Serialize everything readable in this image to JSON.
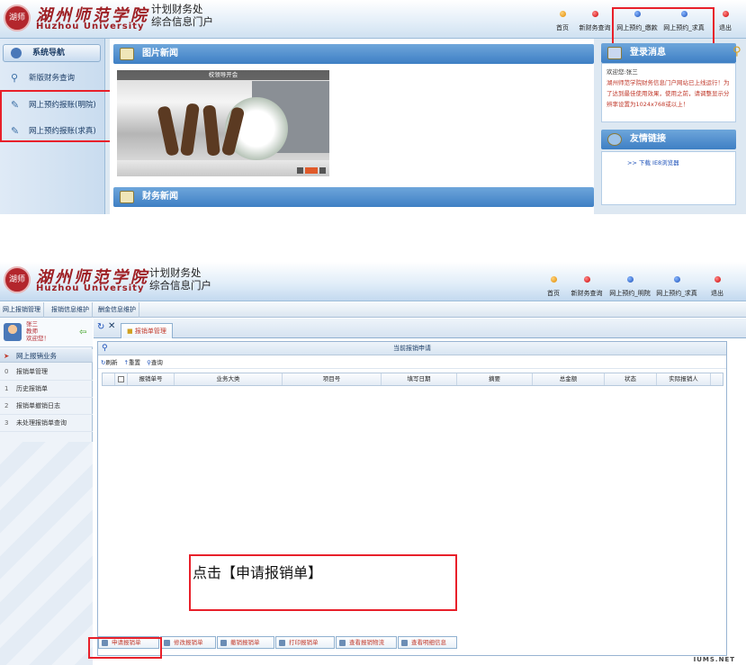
{
  "top": {
    "header": {
      "logo_seal": "湖师",
      "logo_cn": "湖州师范学院",
      "logo_en": "Huzhou University",
      "portal_line1": "计划财务处",
      "portal_line2": "综合信息门户",
      "nav": [
        {
          "label": "首页",
          "dot": "orange"
        },
        {
          "label": "新财务查询",
          "dot": "red"
        },
        {
          "label": "网上预约_缴款",
          "dot": "blue"
        },
        {
          "label": "网上预约_求真",
          "dot": "blue"
        },
        {
          "label": "退出",
          "dot": "red"
        }
      ]
    },
    "sidebar": {
      "title": "系统导航",
      "items": [
        {
          "label": "新版财务查询",
          "icon": "search-icon"
        },
        {
          "label": "网上预约报账(明院)",
          "icon": "edit-icon"
        },
        {
          "label": "网上预约报账(求真)",
          "icon": "edit-icon"
        }
      ]
    },
    "photo_news": {
      "title": "图片新闻",
      "caption": "校领导开会"
    },
    "finance_news": {
      "title": "财务新闻"
    },
    "login_msg": {
      "title": "登录消息",
      "greeting": "欢迎您:张三",
      "body": "湖州师范学院财务信息门户网站已上线运行！为了达到最佳使用效果，使用之前，请调整显示分辨率设置为1024x768或以上！"
    },
    "links": {
      "title": "友情链接",
      "item": ">> 下载 IE8浏览器"
    }
  },
  "bottom": {
    "header": {
      "logo_seal": "湖师",
      "logo_cn": "湖州师范学院",
      "logo_en": "Huzhou University",
      "portal_line1": "计划财务处",
      "portal_line2": "综合信息门户",
      "nav": [
        {
          "label": "首页",
          "dot": "orange"
        },
        {
          "label": "新财务查询",
          "dot": "red"
        },
        {
          "label": "网上预约_明院",
          "dot": "blue"
        },
        {
          "label": "网上预约_求真",
          "dot": "blue"
        },
        {
          "label": "退出",
          "dot": "red"
        }
      ]
    },
    "menubar": [
      "网上报销管理",
      "报销信息维护",
      "酬金信息维护"
    ],
    "user": {
      "name": "张三",
      "role": "教师",
      "welcome": "欢迎您！"
    },
    "side_section": "网上报销业务",
    "side_items": [
      {
        "num": "0",
        "label": "报销单管理"
      },
      {
        "num": "1",
        "label": "历史报销单"
      },
      {
        "num": "2",
        "label": "报销单撤销日志"
      },
      {
        "num": "3",
        "label": "未处理报销单查询"
      }
    ],
    "tab": "报销单管理",
    "grid_title": "当前报销申请",
    "toolbar": [
      "刷新",
      "重置",
      "查询"
    ],
    "columns": [
      "报销单号",
      "业务大类",
      "项目号",
      "填写日期",
      "摘要",
      "总金额",
      "状态",
      "实际报销人"
    ],
    "buttons": [
      "申请报销单",
      "修改报销单",
      "撤销报销单",
      "打印报销单",
      "查看报销物流",
      "查看明细信息"
    ],
    "callout": "点击【申请报销单】",
    "watermark": "IUMS.NET"
  }
}
